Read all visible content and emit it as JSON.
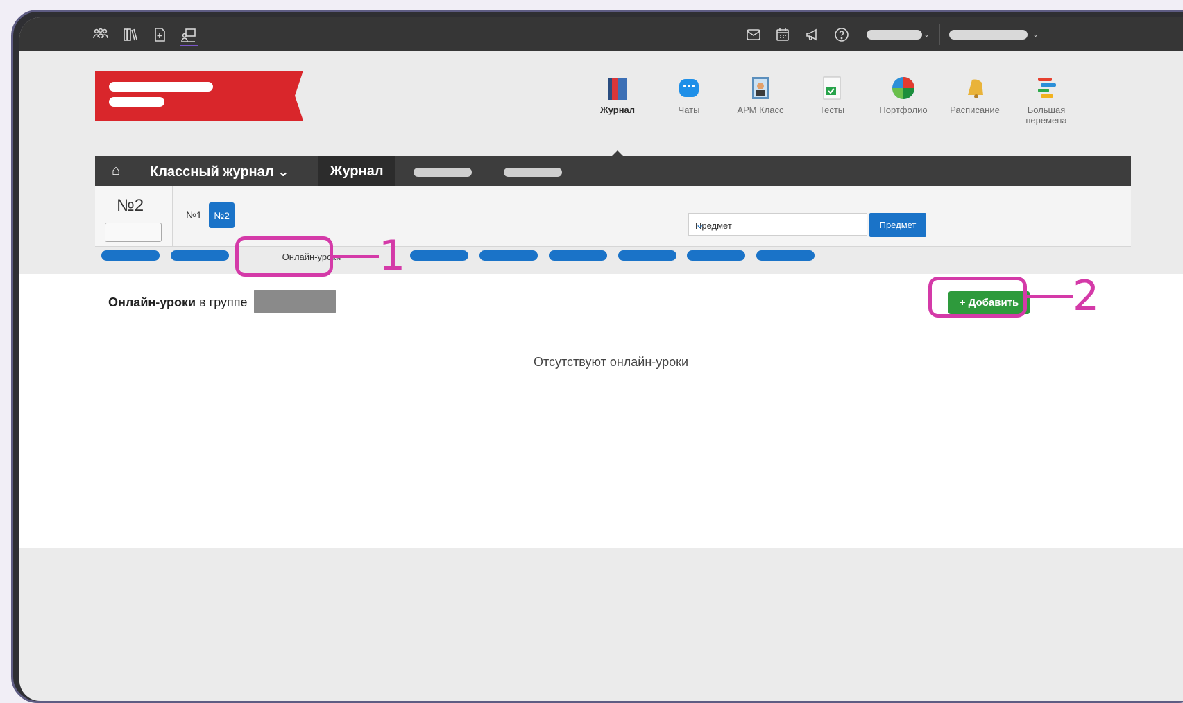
{
  "topbar": {
    "icons": [
      "people-icon",
      "library-icon",
      "add-document-icon",
      "online-lesson-icon"
    ],
    "right_icons": [
      "mail-icon",
      "calendar-icon",
      "megaphone-icon",
      "help-icon"
    ]
  },
  "apps": [
    {
      "label": "Журнал",
      "icon": "journal-icon",
      "active": true
    },
    {
      "label": "Чаты",
      "icon": "chat-icon",
      "active": false
    },
    {
      "label": "АРМ Класс",
      "icon": "arm-class-icon",
      "active": false
    },
    {
      "label": "Тесты",
      "icon": "tests-icon",
      "active": false
    },
    {
      "label": "Портфолио",
      "icon": "portfolio-icon",
      "active": false
    },
    {
      "label": "Расписание",
      "icon": "bell-icon",
      "active": false
    },
    {
      "label": "Большая перемена",
      "icon": "big-break-icon",
      "active": false
    }
  ],
  "nav": {
    "class_journal": "Классный журнал",
    "journal": "Журнал"
  },
  "panel": {
    "class_number": "№2",
    "group1": "№1",
    "group2": "№2",
    "subject_select": "Предмет",
    "subject_button": "Предмет"
  },
  "tabs": {
    "active_label": "Онлайн-уроки"
  },
  "content": {
    "title_bold": "Онлайн-уроки",
    "title_rest": " в группе",
    "empty_text": "Отсутствуют онлайн-уроки",
    "add_button": "+ Добавить"
  },
  "callouts": {
    "one": "1",
    "two": "2"
  },
  "colors": {
    "accent_blue": "#1a73c8",
    "add_green": "#2e9a3c",
    "highlight_pink": "#d43aa8",
    "logo_red": "#d9262b"
  }
}
